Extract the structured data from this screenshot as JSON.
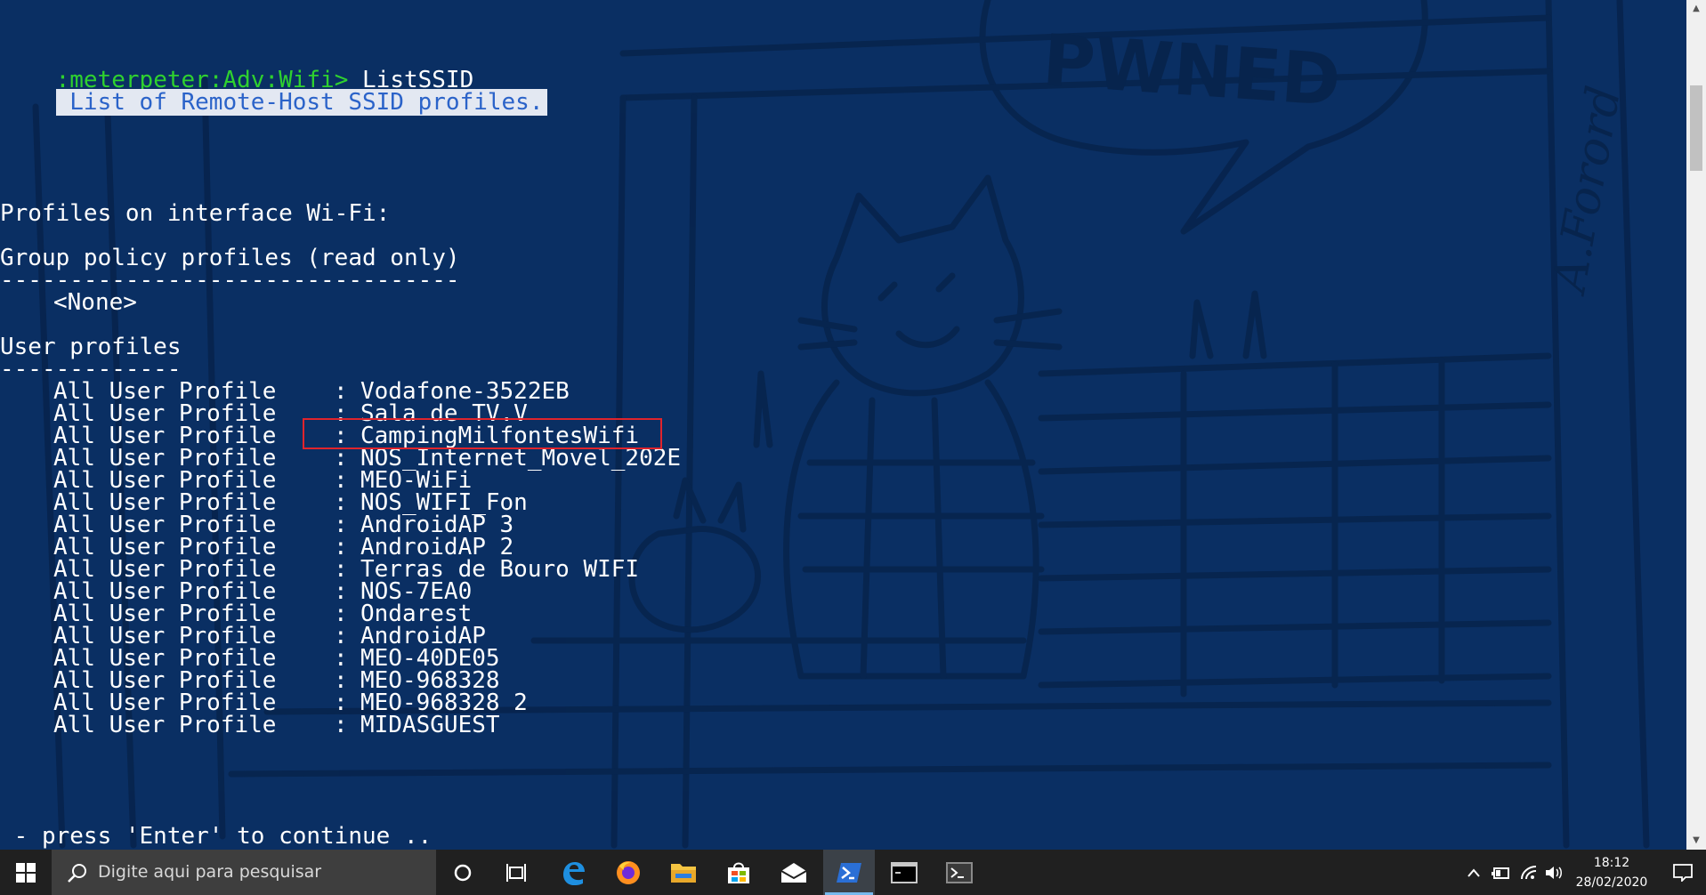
{
  "terminal": {
    "prompt": ":meterpeter:Adv:Wifi>",
    "command": " ListSSID",
    "description": " List of Remote-Host SSID profiles.",
    "profiles_header": "Profiles on interface Wi-Fi:",
    "group_policy_header": "Group policy profiles (read only)",
    "group_policy_rule": "---------------------------------",
    "group_policy_none": "<None>",
    "user_profiles_header": "User profiles",
    "user_profiles_rule": "-------------",
    "profile_label": "All User Profile",
    "separator": ":",
    "user_profiles": [
      "Vodafone-3522EB",
      "Sala de TV.V",
      "CampingMilfontesWifi",
      "NOS_Internet_Movel_202E",
      "MEO-WiFi",
      "NOS_WIFI_Fon",
      "AndroidAP 3",
      "AndroidAP 2",
      "Terras de Bouro WIFI",
      "NOS-7EA0",
      "Ondarest",
      "AndroidAP",
      "MEO-40DE05",
      "MEO-968328",
      "MEO-968328 2",
      "MIDASGUEST"
    ],
    "continue_prompt": " - press 'Enter' to continue .."
  },
  "wallpaper": {
    "speech_text": "PWNED",
    "signature": "A.Forord"
  },
  "taskbar": {
    "search_placeholder": "Digite aqui para pesquisar",
    "time": "18:12",
    "date": "28/02/2020",
    "icons": [
      "windows-start-icon",
      "search-icon",
      "cortana-icon",
      "task-view-icon",
      "edge-icon",
      "firefox-icon",
      "file-explorer-icon",
      "store-icon",
      "mail-icon",
      "powershell-icon",
      "cmd-icon",
      "terminal-icon",
      "tray-chevron-icon",
      "battery-icon",
      "wifi-icon",
      "volume-icon",
      "notification-icon"
    ]
  },
  "colors": {
    "background": "#0a2f63",
    "prompt": "#2fd12f",
    "highlight_bg": "#e3e8f2",
    "highlight_text": "#2b63c9",
    "annotation_box": "#e0242c",
    "taskbar": "#202020"
  }
}
